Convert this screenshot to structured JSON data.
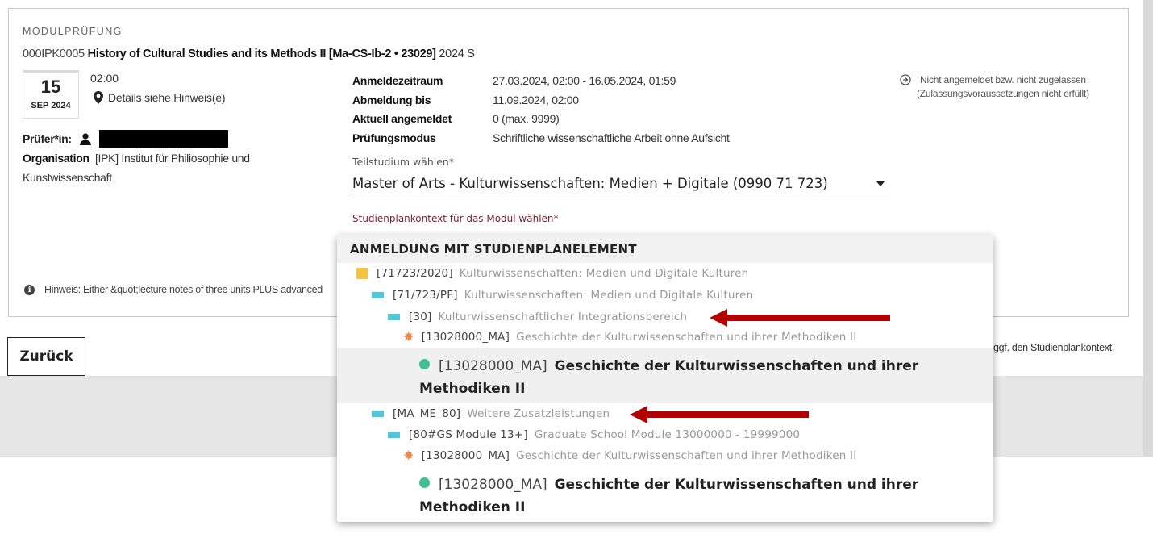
{
  "module": {
    "kicker": "MODULPRÜFUNG",
    "code": "000IPK0005",
    "title": "History of Cultural Studies and its Methods II [Ma-CS-Ib-2 • 23029]",
    "semester": "2024 S",
    "date_day": "15",
    "date_month": "SEP 2024",
    "time": "02:00",
    "location": "Details siehe Hinweis(e)",
    "examiner_label": "Prüfer*in:",
    "org_label": "Organisation",
    "org_value": "[IPK] Institut für Philiosophie und Kunstwissenschaft"
  },
  "info": [
    {
      "key": "Anmeldezeitraum",
      "value": "27.03.2024, 02:00 - 16.05.2024, 01:59"
    },
    {
      "key": "Abmeldung bis",
      "value": "11.09.2024, 02:00"
    },
    {
      "key": "Aktuell angemeldet",
      "value": "0 (max. 9999)"
    },
    {
      "key": "Prüfungsmodus",
      "value": "Schriftliche wissenschaftliche Arbeit ohne Aufsicht"
    }
  ],
  "status": {
    "line1": "Nicht angemeldet bzw. nicht zugelassen",
    "line2": "(Zulassungsvoraussetzungen nicht erfüllt)"
  },
  "teilstudium": {
    "label": "Teilstudium wählen*",
    "value": "Master of Arts - Kulturwissenschaften: Medien + Digitale (0990 71 723)"
  },
  "plan_label": "Studienplankontext für das Modul wählen*",
  "hint": "Hinweis: Either &quot;lecture notes of three units PLUS advanced",
  "back_button": "Zurück",
  "trailing_text": "ggf. den Studienplankontext.",
  "popup": {
    "header": "ANMELDUNG MIT STUDIENPLANELEMENT",
    "items": [
      {
        "code": "[71723/2020]",
        "text": "Kulturwissenschaften: Medien und Digitale Kulturen"
      },
      {
        "code": "[71/723/PF]",
        "text": "Kulturwissenschaften: Medien und Digitale Kulturen"
      },
      {
        "code": "[30]",
        "text": "Kulturwissenschaftlicher Integrationsbereich"
      },
      {
        "code": "[13028000_MA]",
        "text": "Geschichte der Kulturwissenschaften und ihrer Methodiken II"
      },
      {
        "code": "[13028000_MA]",
        "text": "Geschichte der Kulturwissenschaften und ihrer Methodiken II"
      },
      {
        "code": "[MA_ME_80]",
        "text": "Weitere Zusatzleistungen"
      },
      {
        "code": "[80#GS Module 13+]",
        "text": "Graduate School Module 13000000 - 19999000"
      },
      {
        "code": "[13028000_MA]",
        "text": "Geschichte der Kulturwissenschaften und ihrer Methodiken II"
      },
      {
        "code": "[13028000_MA]",
        "text": "Geschichte der Kulturwissenschaften und ihrer Methodiken II"
      }
    ]
  },
  "colors": {
    "folder": "#f5c342",
    "node": "#4fc8dd",
    "module": "#ee8a4a",
    "leaf": "#3fbf93",
    "arrow": "#b30000",
    "plan_label": "#7a1f2a"
  }
}
